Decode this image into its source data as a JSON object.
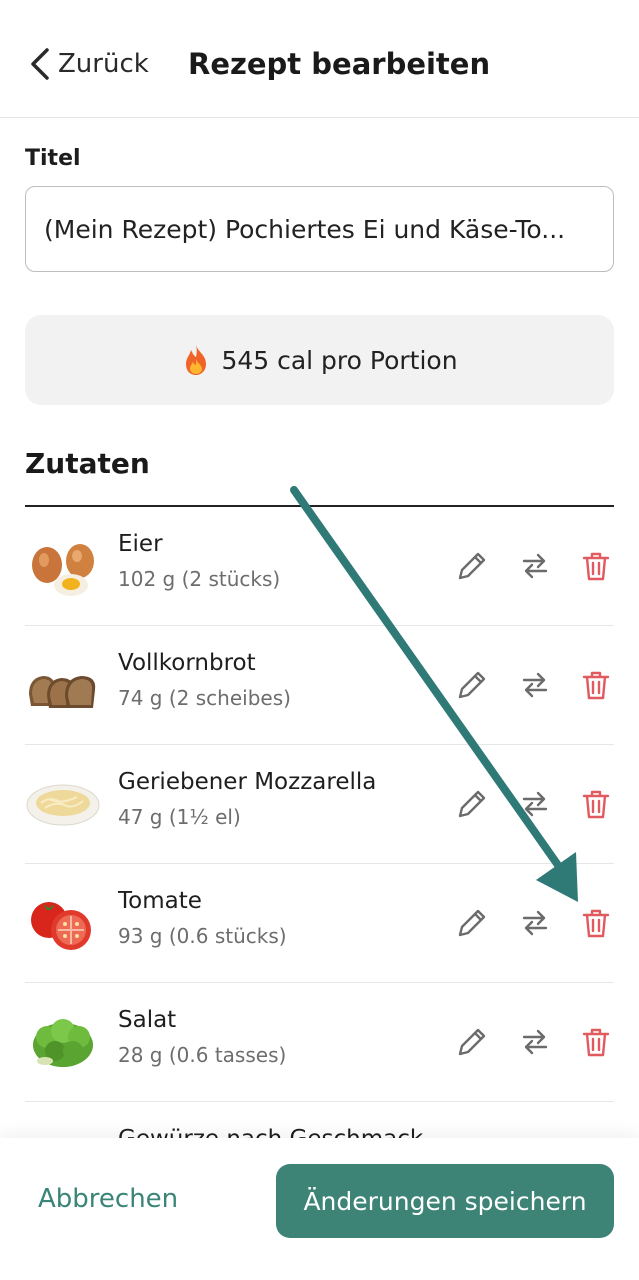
{
  "header": {
    "back_label": "Zurück",
    "title": "Rezept bearbeiten"
  },
  "form": {
    "title_label": "Titel",
    "title_value": "(Mein Rezept) Pochiertes Ei und Käse-To..."
  },
  "calories": {
    "text": "545 cal pro Portion",
    "icon": "fire-icon"
  },
  "ingredients_section": {
    "title": "Zutaten",
    "items": [
      {
        "name": "Eier",
        "amount": "102 g (2 stücks)"
      },
      {
        "name": "Vollkornbrot",
        "amount": "74 g (2 scheibes)"
      },
      {
        "name": "Geriebener Mozzarella",
        "amount": "47 g (1½ el)"
      },
      {
        "name": "Tomate",
        "amount": "93 g (0.6 stücks)"
      },
      {
        "name": "Salat",
        "amount": "28 g (0.6 tasses)"
      },
      {
        "name": "Gewürze nach Geschmack",
        "amount": ""
      }
    ]
  },
  "footer": {
    "cancel_label": "Abbrechen",
    "save_label": "Änderungen speichern"
  },
  "colors": {
    "accent": "#3d8477",
    "delete": "#e05a5f",
    "icon_gray": "#6b6b6b",
    "annotation_arrow": "#2f7a76"
  }
}
